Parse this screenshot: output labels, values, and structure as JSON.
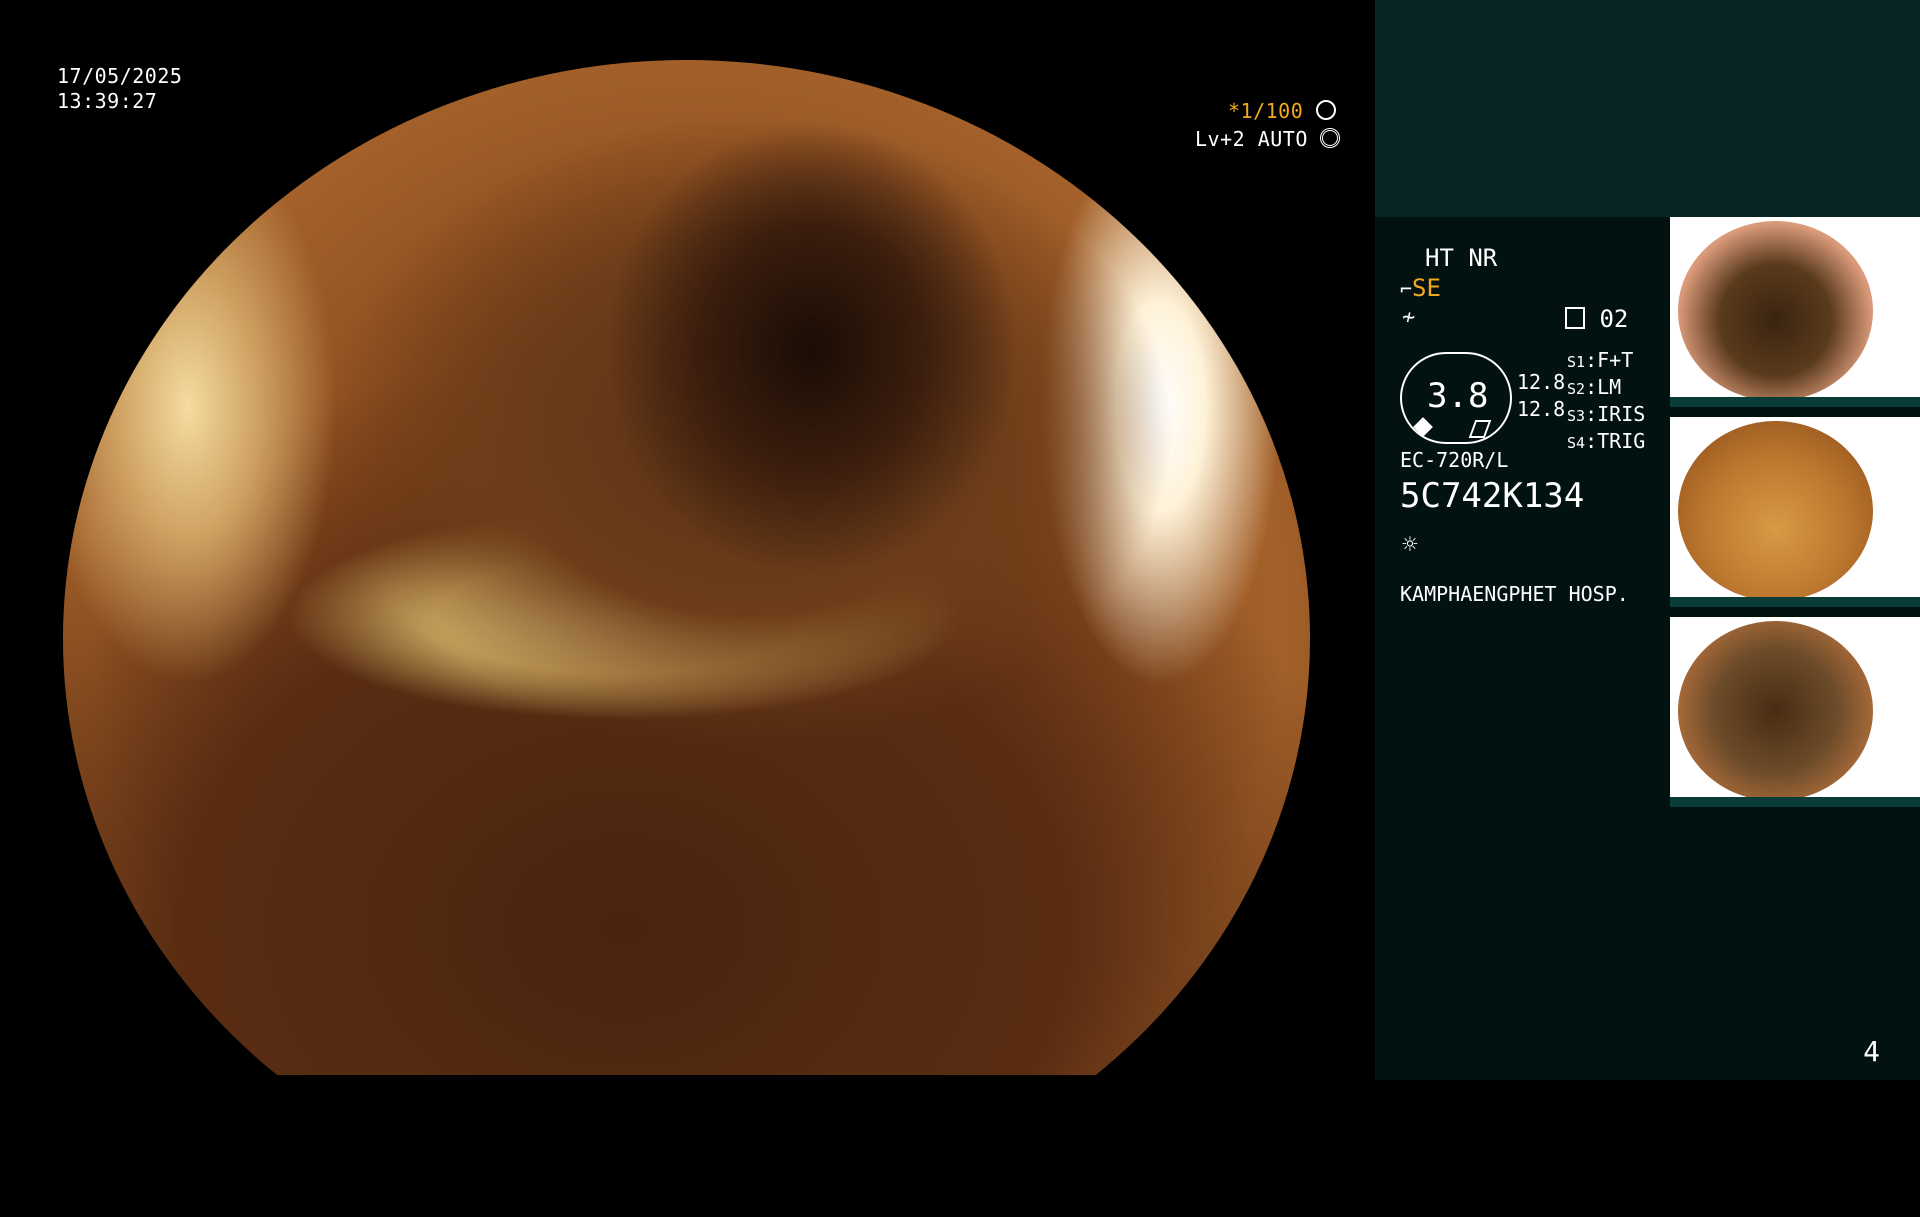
{
  "overlay": {
    "date": "17/05/2025",
    "time": "13:39:27",
    "shutter": "*1/100",
    "shutter_icon": "aperture-icon",
    "iris": "Lv+2 AUTO",
    "iris_icon": "iris-icon"
  },
  "sidebar": {
    "mode": "HT NR",
    "se_label": "SE",
    "se_icon": "scope-tip-icon",
    "freeze_icon": "freeze-icon",
    "record_label": "02",
    "record_icon": "record-icon",
    "gauge_value": "3.8",
    "gauge_value_a": "12.8",
    "gauge_value_b": "12.8",
    "switches": [
      {
        "key": "S1",
        "value": "F+T"
      },
      {
        "key": "S2",
        "value": "LM"
      },
      {
        "key": "S3",
        "value": "IRIS"
      },
      {
        "key": "S4",
        "value": "TRIG"
      }
    ],
    "scope_model": "EC-720R/L",
    "serial": "5C742K134",
    "light_icon": "light-bulb-icon",
    "hospital": "KAMPHAENGPHET HOSP."
  },
  "thumbnails": [
    {
      "label": "thumbnail-1",
      "palette": "mucosa-pink"
    },
    {
      "label": "thumbnail-2",
      "palette": "orange-haze"
    },
    {
      "label": "thumbnail-3",
      "palette": "brown-mucosa"
    }
  ],
  "page_number": "4",
  "colors": {
    "accent_orange": "#f2a81d",
    "sidebar_bg": "#021210",
    "sidebar_top_bg": "#062523"
  }
}
